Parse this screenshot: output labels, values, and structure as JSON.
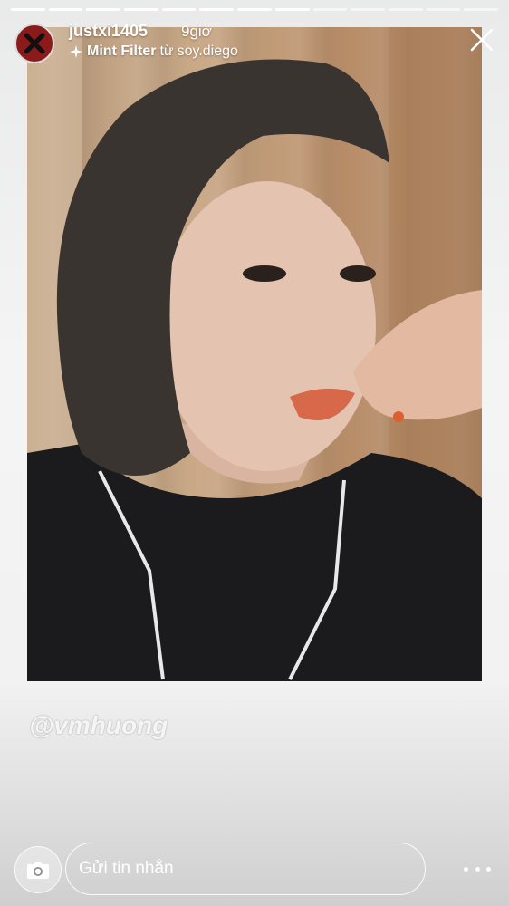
{
  "story": {
    "progress": {
      "total_segments": 13,
      "completed_segments": 8
    },
    "username": "justxi1405",
    "time": "9giờ",
    "filter": {
      "name": "Mint Filter",
      "from_prefix": "từ",
      "author": "soy.diego"
    },
    "watermark": "@vmhuong"
  },
  "footer": {
    "message_placeholder": "Gửi tin nhắn"
  },
  "icons": {
    "avatar": "x-mark-avatar-icon",
    "filter": "sparkle-icon",
    "close": "close-icon",
    "camera": "camera-icon",
    "more": "more-dots-icon"
  },
  "colors": {
    "avatar_bg": "#8b1b1b",
    "text": "#ffffff"
  }
}
